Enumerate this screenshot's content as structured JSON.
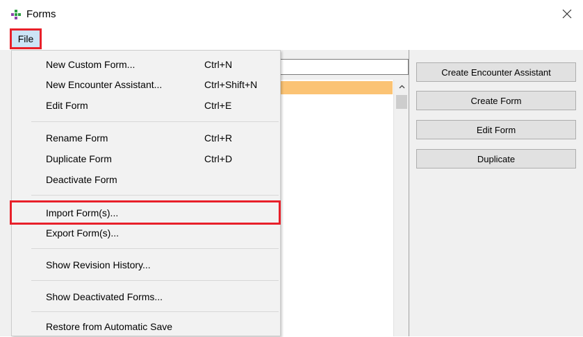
{
  "window": {
    "title": "Forms"
  },
  "menubar": {
    "file_label": "File"
  },
  "file_menu": {
    "items": [
      {
        "label": "New Custom Form...",
        "shortcut": "Ctrl+N"
      },
      {
        "label": "New Encounter Assistant...",
        "shortcut": "Ctrl+Shift+N"
      },
      {
        "label": "Edit Form",
        "shortcut": "Ctrl+E"
      },
      {
        "label": "Rename Form",
        "shortcut": "Ctrl+R"
      },
      {
        "label": "Duplicate Form",
        "shortcut": "Ctrl+D"
      },
      {
        "label": "Deactivate Form",
        "shortcut": ""
      },
      {
        "label": "Import Form(s)...",
        "shortcut": ""
      },
      {
        "label": "Export Form(s)...",
        "shortcut": ""
      },
      {
        "label": "Show Revision History...",
        "shortcut": ""
      },
      {
        "label": "Show Deactivated Forms...",
        "shortcut": ""
      },
      {
        "label": "Restore from Automatic Save",
        "shortcut": ""
      }
    ]
  },
  "right_panel": {
    "buttons": [
      {
        "label": "Create Encounter Assistant"
      },
      {
        "label": "Create Form"
      },
      {
        "label": "Edit Form"
      },
      {
        "label": "Duplicate"
      }
    ]
  },
  "search": {
    "value": ""
  },
  "colors": {
    "highlight_border": "#e8202a",
    "selected_row": "#fbc374",
    "menu_background": "#f2f2f2",
    "button_face": "#e1e1e1"
  }
}
